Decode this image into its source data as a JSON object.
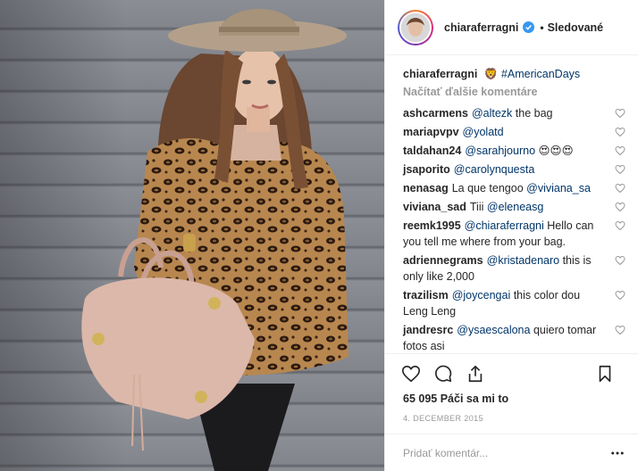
{
  "post": {
    "author": "chiaraferragni",
    "follow_status": "Sledované",
    "caption": {
      "user": "chiaraferragni",
      "emoji": "🦁",
      "text": "#AmericanDays"
    },
    "load_more": "Načítať ďalšie komentáre",
    "comments": [
      {
        "user": "ashcarmens",
        "mention": "@altezk",
        "text": " the bag"
      },
      {
        "user": "mariapvpv",
        "mention": "@yolatd",
        "text": ""
      },
      {
        "user": "taldahan24",
        "mention": "@sarahjourno",
        "text": " 😍😍😍"
      },
      {
        "user": "jsaporito",
        "mention": "@carolynquesta",
        "text": ""
      },
      {
        "user": "nenasag",
        "mention": "",
        "text": "La que tengoo ",
        "mention2": "@viviana_sa"
      },
      {
        "user": "viviana_sad",
        "mention": "",
        "text": "Tiii ",
        "mention2": "@eleneasg"
      },
      {
        "user": "reemk1995",
        "mention": "@chiaraferragni",
        "text": " Hello can you tell me where from your bag."
      },
      {
        "user": "adriennegrams",
        "mention": "@kristadenaro",
        "text": " this is only like 2,000"
      },
      {
        "user": "trazilism",
        "mention": "@joycengai",
        "text": " this color dou Leng Leng"
      },
      {
        "user": "jandresrc",
        "mention": "@ysaescalona",
        "text": " quiero tomar fotos asi"
      }
    ],
    "likes": "65 095 Páči sa mi to",
    "date": "4. DECEMBER 2015",
    "add_comment_placeholder": "Pridať komentár..."
  },
  "colors": {
    "link": "#003569",
    "muted": "#999999",
    "border": "#efefef",
    "verified": "#3897f0"
  }
}
